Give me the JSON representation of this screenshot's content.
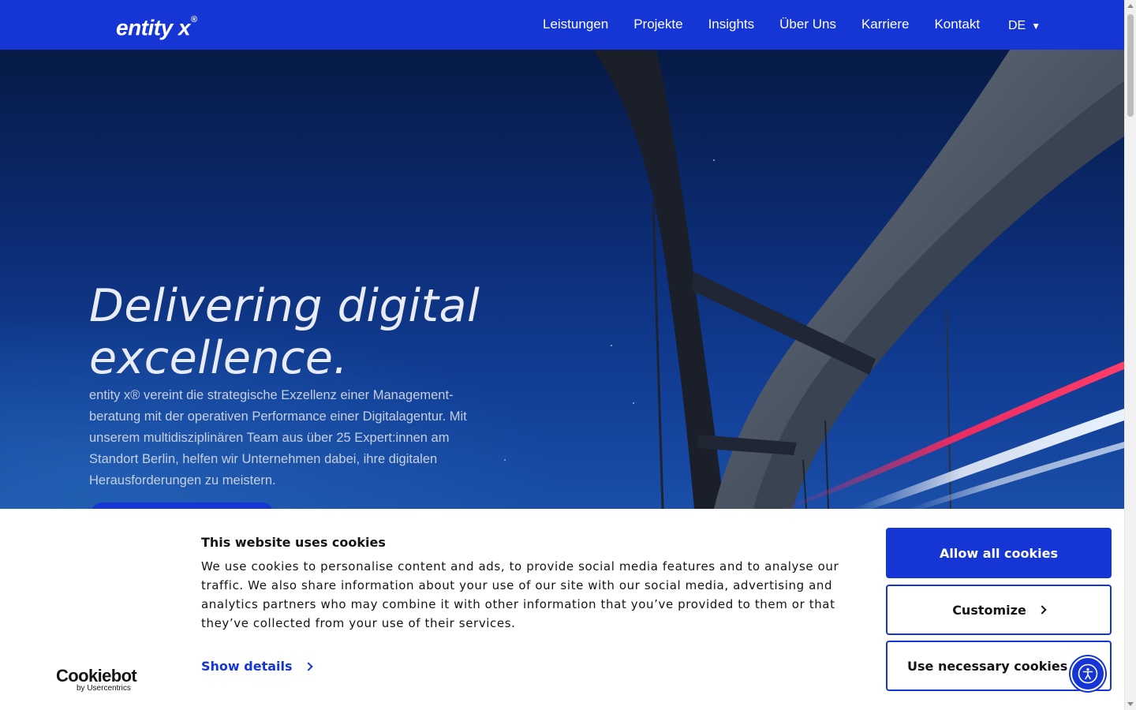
{
  "header": {
    "logo": "entity x",
    "logo_mark": "®",
    "nav": [
      "Leistungen",
      "Projekte",
      "Insights",
      "Über Uns",
      "Karriere",
      "Kontakt"
    ],
    "language": "DE",
    "language_icon": "caret-down-icon"
  },
  "hero": {
    "headline_line1": "Delivering digital",
    "headline_line2": "excellence.",
    "intro": "entity x® vereint die strategische Exzellenz einer Management-beratung mit der operativen Performance einer Digitalagentur. Mit unserem multidisziplinären Team aus über 25 Expert:innen am Standort Berlin, helfen wir Unternehmen dabei, ihre digitalen Herausforderungen zu meistern."
  },
  "cookie_banner": {
    "brand": "Cookiebot",
    "brand_sub": "by Usercentrics",
    "title": "This website uses cookies",
    "text": "We use cookies to personalise content and ads, to provide social media features and to analyse our traffic. We also share information about your use of our site with our social media, advertising and analytics partners who may combine it with other information that you’ve provided to them or that they’ve collected from your use of their services.",
    "show_details": "Show details",
    "allow_all": "Allow all cookies",
    "customize": "Customize",
    "necessary_only": "Use necessary cookies only"
  },
  "accessibility": {
    "icon": "accessibility-icon"
  },
  "colors": {
    "brand": "#1535d4",
    "hero_dark": "#071a45",
    "text": "#141414"
  }
}
